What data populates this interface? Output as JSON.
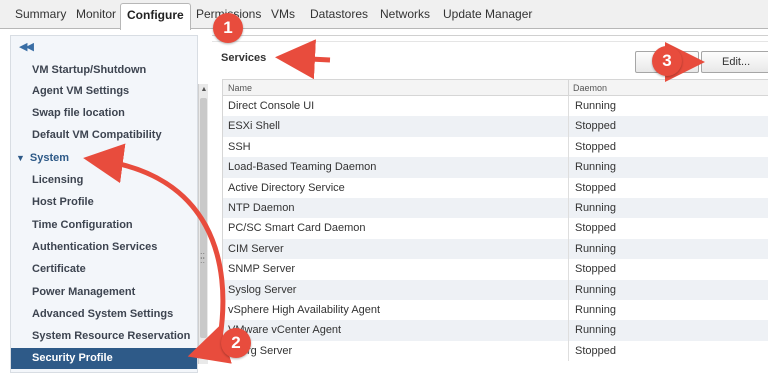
{
  "tabs": [
    {
      "label": "Summary"
    },
    {
      "label": "Monitor"
    },
    {
      "label": "Configure",
      "active": true
    },
    {
      "label": "Permissions"
    },
    {
      "label": "VMs"
    },
    {
      "label": "Datastores"
    },
    {
      "label": "Networks"
    },
    {
      "label": "Update Manager"
    }
  ],
  "sidebar": {
    "collapse_icon": "double-chevron-left-icon",
    "items": [
      {
        "label": "VM Startup/Shutdown"
      },
      {
        "label": "Agent VM Settings"
      },
      {
        "label": "Swap file location"
      },
      {
        "label": "Default VM Compatibility"
      },
      {
        "label": "System",
        "group": true
      },
      {
        "label": "Licensing"
      },
      {
        "label": "Host Profile"
      },
      {
        "label": "Time Configuration"
      },
      {
        "label": "Authentication Services"
      },
      {
        "label": "Certificate"
      },
      {
        "label": "Power Management"
      },
      {
        "label": "Advanced System Settings"
      },
      {
        "label": "System Resource Reservation"
      },
      {
        "label": "Security Profile",
        "selected": true
      }
    ]
  },
  "services": {
    "title": "Services",
    "edit_label": "Edit...",
    "columns": {
      "name": "Name",
      "daemon": "Daemon"
    },
    "rows": [
      {
        "name": "Direct Console UI",
        "daemon": "Running"
      },
      {
        "name": "ESXi Shell",
        "daemon": "Stopped"
      },
      {
        "name": "SSH",
        "daemon": "Stopped"
      },
      {
        "name": "Load-Based Teaming Daemon",
        "daemon": "Running"
      },
      {
        "name": "Active Directory Service",
        "daemon": "Stopped"
      },
      {
        "name": "NTP Daemon",
        "daemon": "Running"
      },
      {
        "name": "PC/SC Smart Card Daemon",
        "daemon": "Stopped"
      },
      {
        "name": "CIM Server",
        "daemon": "Running"
      },
      {
        "name": "SNMP Server",
        "daemon": "Stopped"
      },
      {
        "name": "Syslog Server",
        "daemon": "Running"
      },
      {
        "name": "vSphere High Availability Agent",
        "daemon": "Running"
      },
      {
        "name": "VMware vCenter Agent",
        "daemon": "Running"
      },
      {
        "name": "X.Org Server",
        "daemon": "Stopped"
      }
    ]
  },
  "annotations": {
    "callout_1": "1",
    "callout_2": "2",
    "callout_3": "3",
    "color": "#e84c3d"
  },
  "colors": {
    "selected_bg": "#2e5a88",
    "alt_row": "#eef1f5"
  }
}
